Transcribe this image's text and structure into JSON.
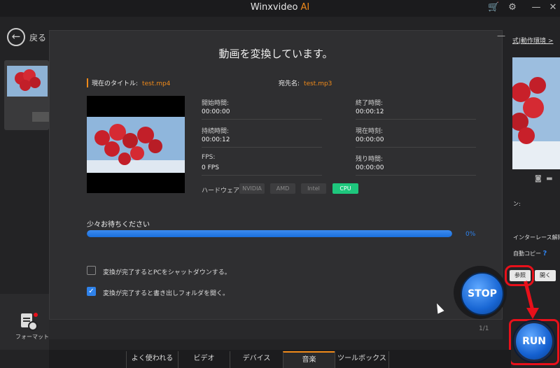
{
  "app": {
    "title": "Winxvideo",
    "title_suffix": "AI"
  },
  "nav": {
    "back_label": "戻る"
  },
  "dialog": {
    "title": "動画を変換しています。",
    "current_title_label": "現在のタイトル:",
    "current_title_value": "test.mp4",
    "dest_label": "宛先名:",
    "dest_value": "test.mp3",
    "fields": {
      "start_time": {
        "label": "開始時間:",
        "value": "00:00:00"
      },
      "end_time": {
        "label": "終了時間:",
        "value": "00:00:12"
      },
      "duration": {
        "label": "持続時間:",
        "value": "00:00:12"
      },
      "current_time": {
        "label": "現在時刻:",
        "value": "00:00:00"
      },
      "fps": {
        "label": "FPS:",
        "value": "0 FPS"
      },
      "remaining": {
        "label": "残り時間:",
        "value": "00:00:00"
      }
    },
    "hardware_label": "ハードウェア:",
    "hardware": [
      "NVIDIA",
      "AMD",
      "Intel",
      "CPU"
    ],
    "hardware_active": "CPU",
    "wait_label": "少々お待ちください",
    "progress_percent": 0,
    "progress_text": "0%",
    "options": [
      {
        "label": "変換が完了するとPCをシャットダウンする。",
        "checked": false
      },
      {
        "label": "変換が完了すると書き出しフォルダを開く。",
        "checked": true
      }
    ],
    "page": "1/1",
    "stop_label": "STOP"
  },
  "right_panel": {
    "link": "式|動作環境 >",
    "colon_text": "ン:",
    "deinterlace": "インターレース解除",
    "auto_copy": "自動コピー",
    "help": "?",
    "browse": "参照",
    "open": "開く",
    "run_label": "RUN"
  },
  "sidebar": {
    "format_label": "フォーマット"
  },
  "bottom_tabs": [
    "よく使われる",
    "ビデオ",
    "デバイス",
    "音楽",
    "ツールボックス"
  ],
  "bottom_tab_active": "音楽",
  "colors": {
    "accent": "#f08a1a",
    "progress": "#1a6fdc",
    "cpu": "#1ec77d",
    "highlight": "#e8101a"
  }
}
